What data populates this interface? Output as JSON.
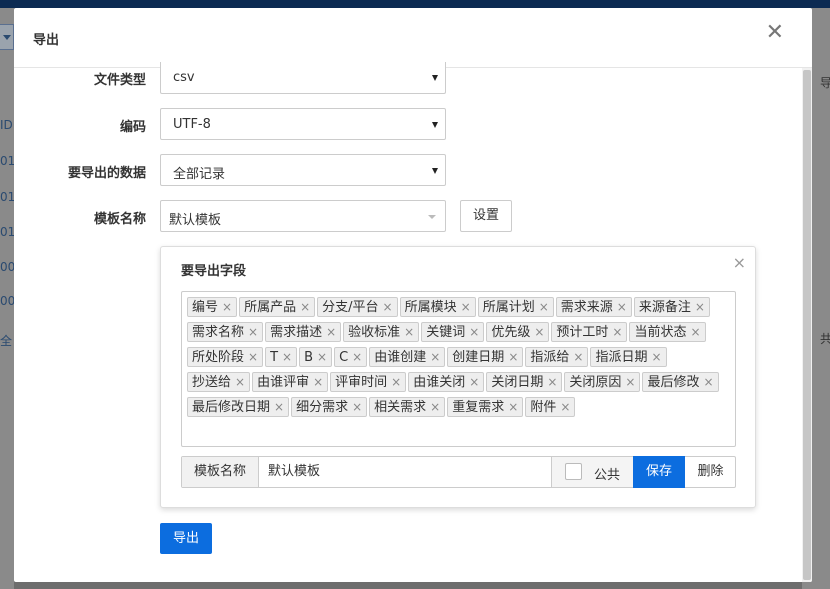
{
  "background": {
    "left_fragments": [
      "ID",
      "01",
      "01",
      "01",
      "00",
      "00",
      "全"
    ],
    "right_fragments": [
      "导",
      "共"
    ]
  },
  "modal": {
    "title": "导出",
    "close_glyph": "✕"
  },
  "form": {
    "file_type": {
      "label": "文件类型",
      "value": "csv"
    },
    "encoding": {
      "label": "编码",
      "value": "UTF-8"
    },
    "data_scope": {
      "label": "要导出的数据",
      "value": "全部记录"
    },
    "template": {
      "label": "模板名称",
      "value": "默认模板",
      "settings_button": "设置"
    }
  },
  "fields_panel": {
    "title": "要导出字段",
    "close_glyph": "×",
    "tag_remove_glyph": "×",
    "tags": [
      "编号",
      "所属产品",
      "分支/平台",
      "所属模块",
      "所属计划",
      "需求来源",
      "来源备注",
      "需求名称",
      "需求描述",
      "验收标准",
      "关键词",
      "优先级",
      "预计工时",
      "当前状态",
      "所处阶段",
      "T",
      "B",
      "C",
      "由谁创建",
      "创建日期",
      "指派给",
      "指派日期",
      "抄送给",
      "由谁评审",
      "评审时间",
      "由谁关闭",
      "关闭日期",
      "关闭原因",
      "最后修改",
      "最后修改日期",
      "细分需求",
      "相关需求",
      "重复需求",
      "附件"
    ],
    "template_label": "模板名称",
    "template_value": "默认模板",
    "public_label": "公共",
    "save_button": "保存",
    "delete_button": "删除"
  },
  "export_button": "导出",
  "colors": {
    "primary": "#0c6ddf",
    "overlay": "#6d6d6d"
  }
}
